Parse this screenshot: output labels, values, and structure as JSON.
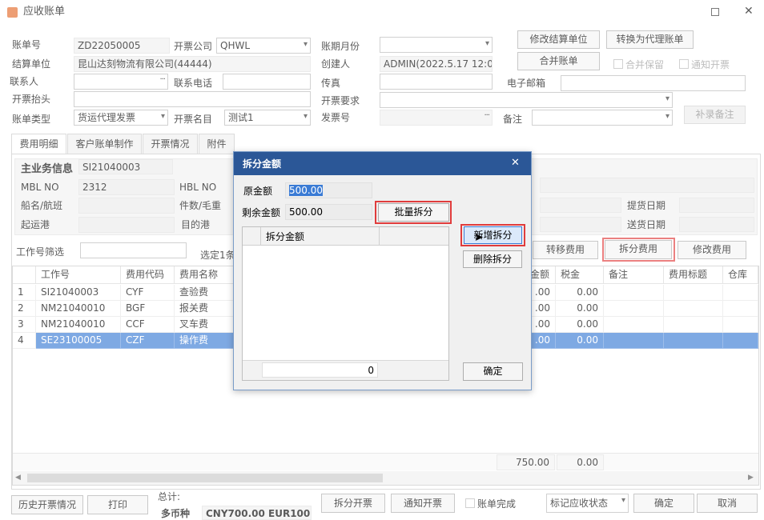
{
  "window": {
    "title": "应收账单"
  },
  "form": {
    "bill_no_label": "账单号",
    "bill_no": "ZD22050005",
    "invoice_company_label": "开票公司",
    "invoice_company": "QHWL",
    "period_label": "账期月份",
    "period": "",
    "settle_unit_label": "结算单位",
    "settle_unit": "昆山达刻物流有限公司(44444)",
    "creator_label": "创建人",
    "creator": "ADMIN(2022.5.17 12:0",
    "contact_label": "联系人",
    "contact": "",
    "phone_label": "联系电话",
    "phone": "",
    "fax_label": "传真",
    "fax": "",
    "email_label": "电子邮箱",
    "email": "",
    "invoice_header_label": "开票抬头",
    "invoice_header": "",
    "invoice_req_label": "开票要求",
    "invoice_req": "",
    "bill_type_label": "账单类型",
    "bill_type": "货运代理发票",
    "invoice_item_label": "开票名目",
    "invoice_item": "测试1",
    "invoice_no_label": "发票号",
    "invoice_no": "",
    "remark_label": "备注",
    "remark": ""
  },
  "top_buttons": {
    "modify_settle_unit": "修改结算单位",
    "convert_agent_bill": "转换为代理账单",
    "merge_bill": "合并账单",
    "merge_keep": "合并保留",
    "notify_invoice": "通知开票",
    "supplement_remark": "补录备注"
  },
  "tabs": [
    "费用明细",
    "客户账单制作",
    "开票情况",
    "附件"
  ],
  "biz_info": {
    "title": "主业务信息",
    "job_id": "SI21040003",
    "mbl_label": "MBL NO",
    "mbl": "2312",
    "hbl_label": "HBL NO",
    "vessel_label": "船名/航班",
    "pieces_label": "件数/毛重",
    "pol_label": "起运港",
    "pod_label": "目的港",
    "pickup_date_label": "提货日期",
    "delivery_date_label": "送货日期"
  },
  "filter": {
    "label": "工作号筛选",
    "value": "",
    "selected_text": "选定1条"
  },
  "grid_buttons": {
    "transfer_fee": "转移费用",
    "split_fee": "拆分费用",
    "modify_fee": "修改费用"
  },
  "grid": {
    "columns": [
      "工作号",
      "费用代码",
      "费用名称",
      "金额",
      "税金",
      "备注",
      "费用标题",
      "仓库"
    ],
    "rows": [
      {
        "no": "1",
        "job": "SI21040003",
        "code": "CYF",
        "name": "查验费",
        "amount": ".00",
        "tax": "0.00"
      },
      {
        "no": "2",
        "job": "NM21040010",
        "code": "BGF",
        "name": "报关费",
        "amount": ".00",
        "tax": "0.00"
      },
      {
        "no": "3",
        "job": "NM21040010",
        "code": "CCF",
        "name": "叉车费",
        "amount": ".00",
        "tax": "0.00"
      },
      {
        "no": "4",
        "job": "SE23100005",
        "code": "CZF",
        "name": "操作费",
        "amount": ".00",
        "tax": "0.00"
      }
    ],
    "total_amount": "750.00",
    "total_tax": "0.00"
  },
  "footer": {
    "history_invoice": "历史开票情况",
    "print": "打印",
    "total_label": "总计:",
    "multi_currency_label": "多币种",
    "multi_currency_value": "CNY700.00 EUR100.0",
    "split_invoice": "拆分开票",
    "notify_invoice": "通知开票",
    "bill_done": "账单完成",
    "mark_status": "标记应收状态",
    "ok": "确定",
    "cancel": "取消"
  },
  "dialog": {
    "title": "拆分金额",
    "orig_label": "原金额",
    "orig_value": "500.00",
    "remain_label": "剩余金额",
    "remain_value": "500.00",
    "batch_split": "批量拆分",
    "col_split_amount": "拆分金额",
    "sum_value": "0",
    "add_split": "新增拆分",
    "delete_split": "删除拆分",
    "confirm": "确定"
  },
  "colors": {
    "accent": "#3a7bd5",
    "highlight": "#e03c3c",
    "dialog_title": "#2b5797"
  }
}
